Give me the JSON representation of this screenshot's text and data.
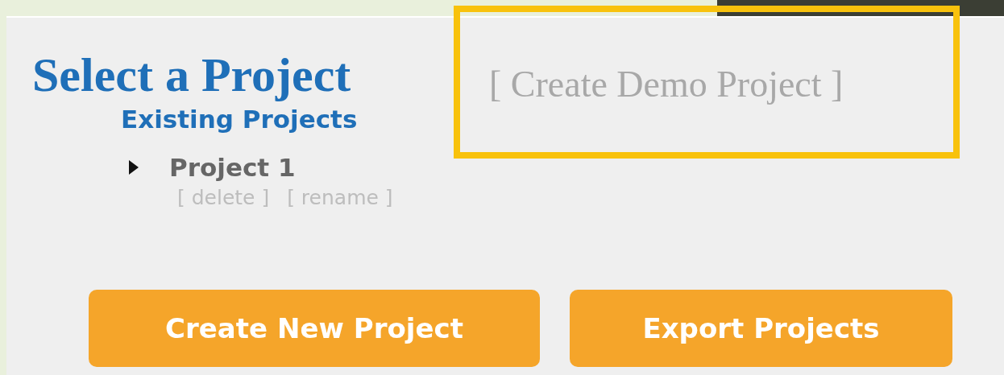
{
  "title": "Select a Project",
  "demo_link": "[ Create Demo Project ]",
  "section_heading": "Existing Projects",
  "projects": [
    {
      "name": "Project 1",
      "expanded": false,
      "actions": [
        "[ delete ]",
        "[ rename ]"
      ]
    }
  ],
  "buttons": [
    "Create New Project",
    "Export Projects"
  ]
}
